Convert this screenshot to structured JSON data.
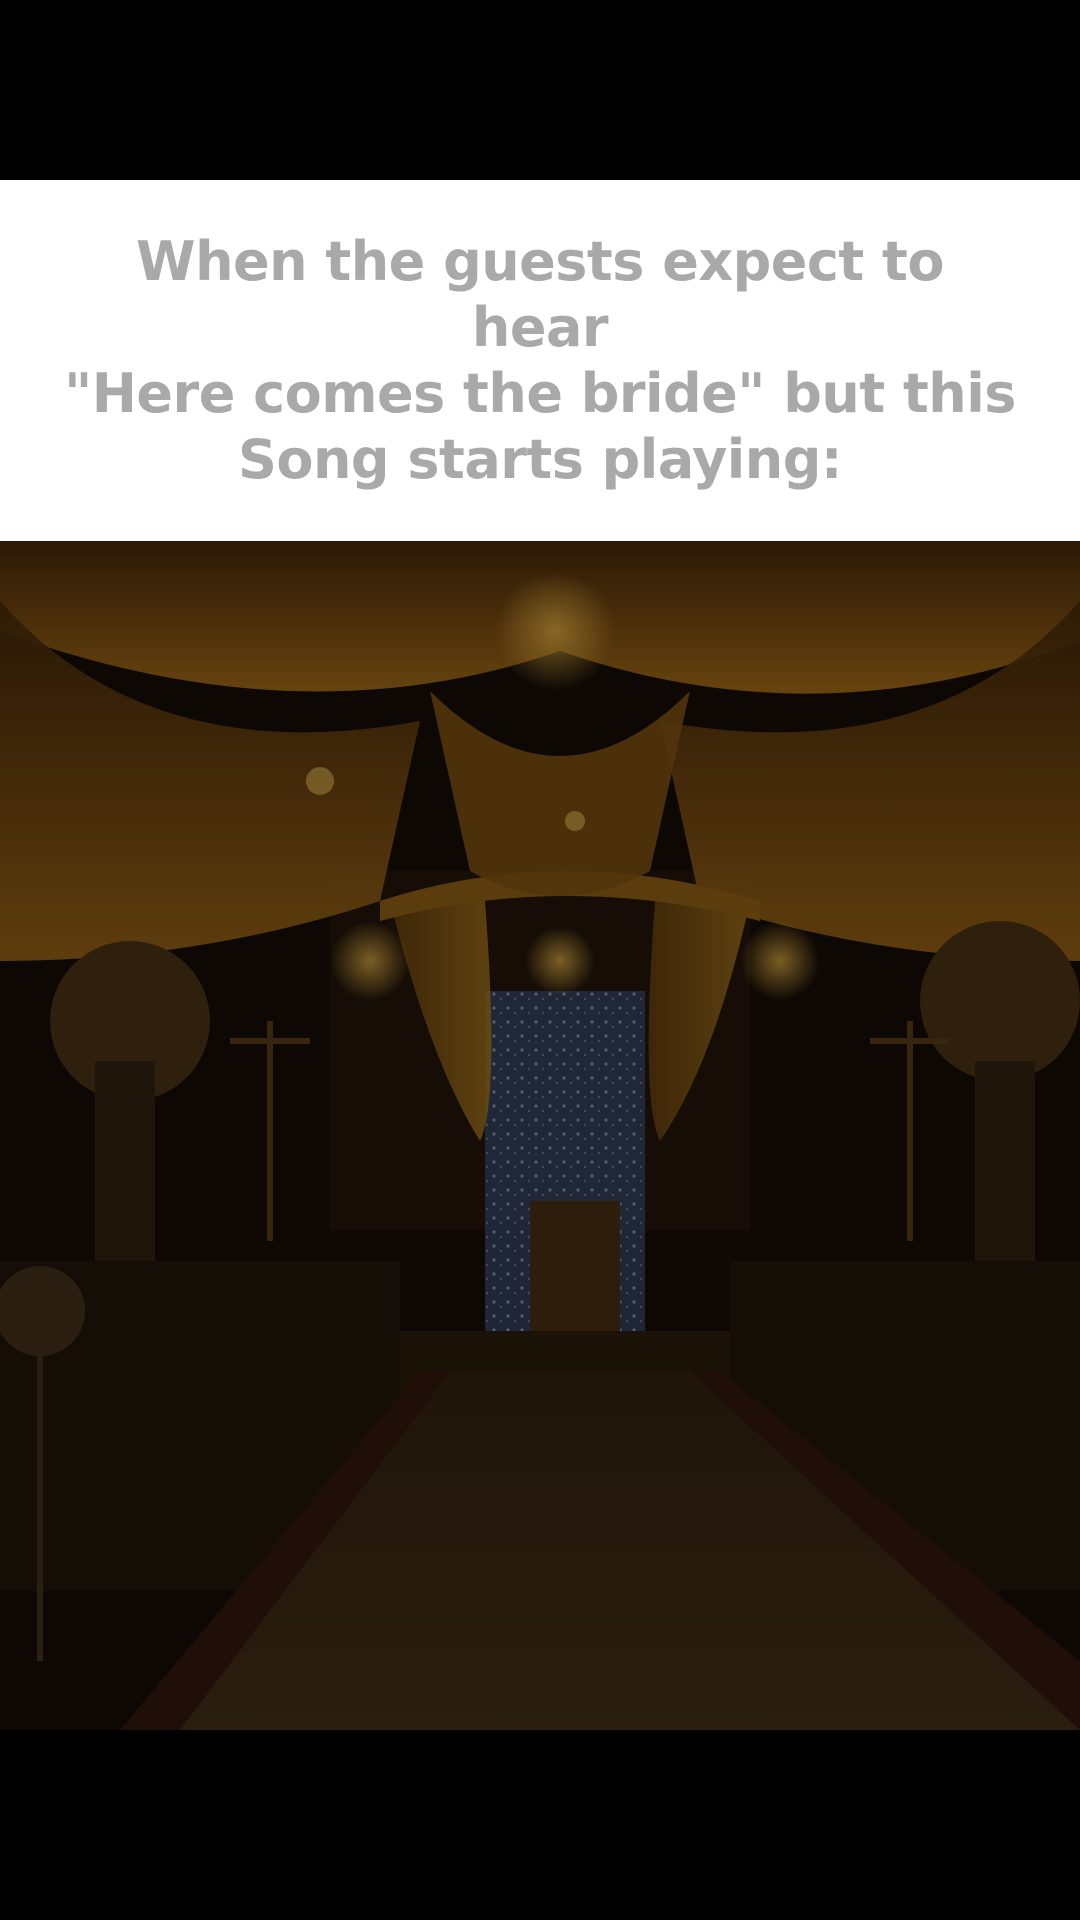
{
  "caption": {
    "lines": [
      "When the guests expect to hear",
      "\"Here comes the bride\" but this",
      "Song starts playing:"
    ]
  },
  "image": {
    "subject": "wedding-aisle-photo"
  },
  "colors": {
    "background": "#000000",
    "caption_panel": "#ffffff",
    "caption_text": "#a9a9a9",
    "drape_gold": "#8a5a14",
    "backdrop_blue": "#4a5f8a"
  }
}
